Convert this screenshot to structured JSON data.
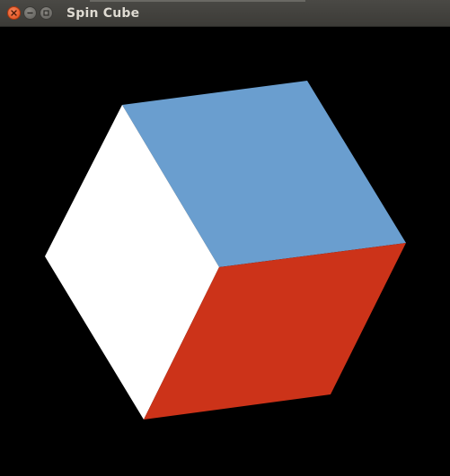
{
  "window": {
    "title": "Spin Cube"
  },
  "controls": {
    "close_icon": "close-icon",
    "minimize_icon": "minimize-icon",
    "maximize_icon": "maximize-icon"
  },
  "scene": {
    "background": "#000000",
    "faces": [
      {
        "name": "top",
        "color": "#6a9ecf"
      },
      {
        "name": "left",
        "color": "#ffffff"
      },
      {
        "name": "right",
        "color": "#cc3319"
      }
    ]
  }
}
